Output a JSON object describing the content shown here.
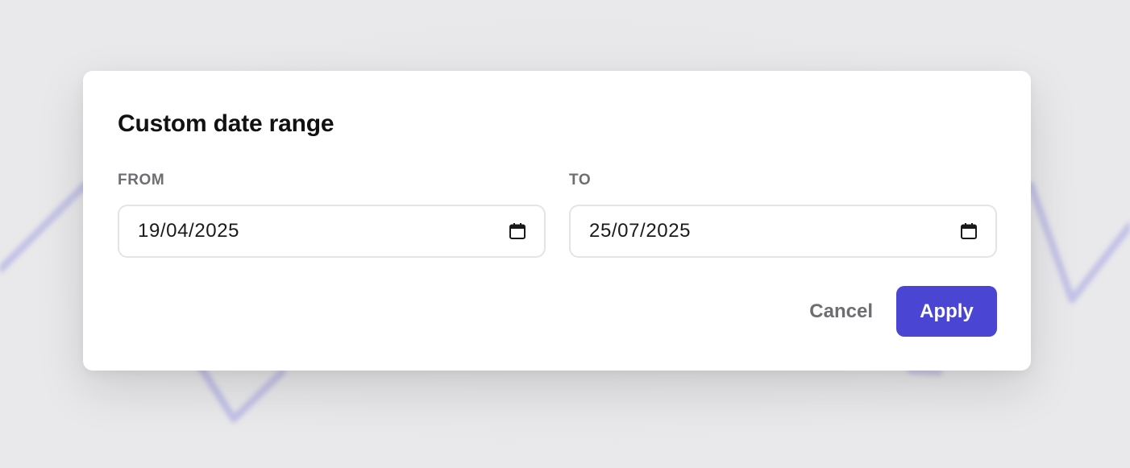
{
  "dialog": {
    "title": "Custom date range",
    "from": {
      "label": "FROM",
      "value": "19/04/2025",
      "icon": "calendar-icon"
    },
    "to": {
      "label": "TO",
      "value": "25/07/2025",
      "icon": "calendar-icon"
    },
    "cancel_label": "Cancel",
    "apply_label": "Apply"
  },
  "colors": {
    "accent": "#4a45d2",
    "backdrop": "#e9e9eb",
    "backdrop_line": "#8c88e0",
    "label": "#6e6e72"
  }
}
